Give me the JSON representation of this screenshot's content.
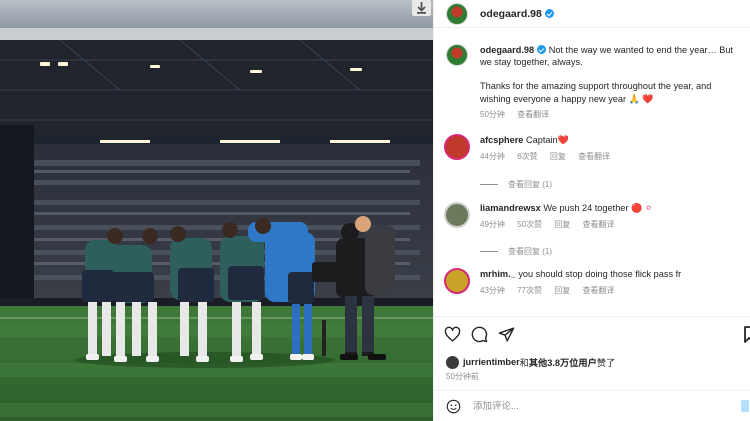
{
  "post": {
    "author": "odegaard.98",
    "caption_line1": "Not the way we wanted to end the year… But we stay together, always.",
    "caption_line2": "Thanks for the amazing support throughout the year, and wishing everyone a happy new year",
    "caption_emoji": "🙏 ❤️",
    "time": "50分钟",
    "translate": "查看翻译"
  },
  "comments": [
    {
      "user": "afcsphere",
      "text": "Captain",
      "emoji": "❤️",
      "time": "44分钟",
      "likes": "6次赞",
      "reply": "回复",
      "translate": "查看翻译",
      "view_replies": "查看回复 (1)",
      "avatar_color": "#c0392b"
    },
    {
      "user": "liamandrewsx",
      "text": "We push 24 together",
      "emoji": "🔴 ⚪",
      "time": "49分钟",
      "likes": "50次赞",
      "reply": "回复",
      "translate": "查看翻译",
      "view_replies": "查看回复 (1)",
      "avatar_color": "#6b7a5a"
    },
    {
      "user": "mrhim._",
      "text": "you should stop doing those flick pass fr",
      "emoji": "",
      "time": "43分钟",
      "likes": "77次赞",
      "reply": "回复",
      "translate": "查看翻译",
      "view_replies": "",
      "avatar_color": "#c9a227"
    }
  ],
  "likes_line": {
    "liker": "jurrientimber",
    "connector": "和",
    "others": "其他3.8万位用户",
    "suffix": "赞了"
  },
  "post_time": "50分钟前",
  "add_comment": {
    "placeholder": "添加评论..."
  },
  "icons": {
    "download": "download-icon",
    "like": "heart-icon",
    "comment": "comment-icon",
    "share": "send-icon",
    "save": "bookmark-icon",
    "emoji": "smiley-icon"
  }
}
